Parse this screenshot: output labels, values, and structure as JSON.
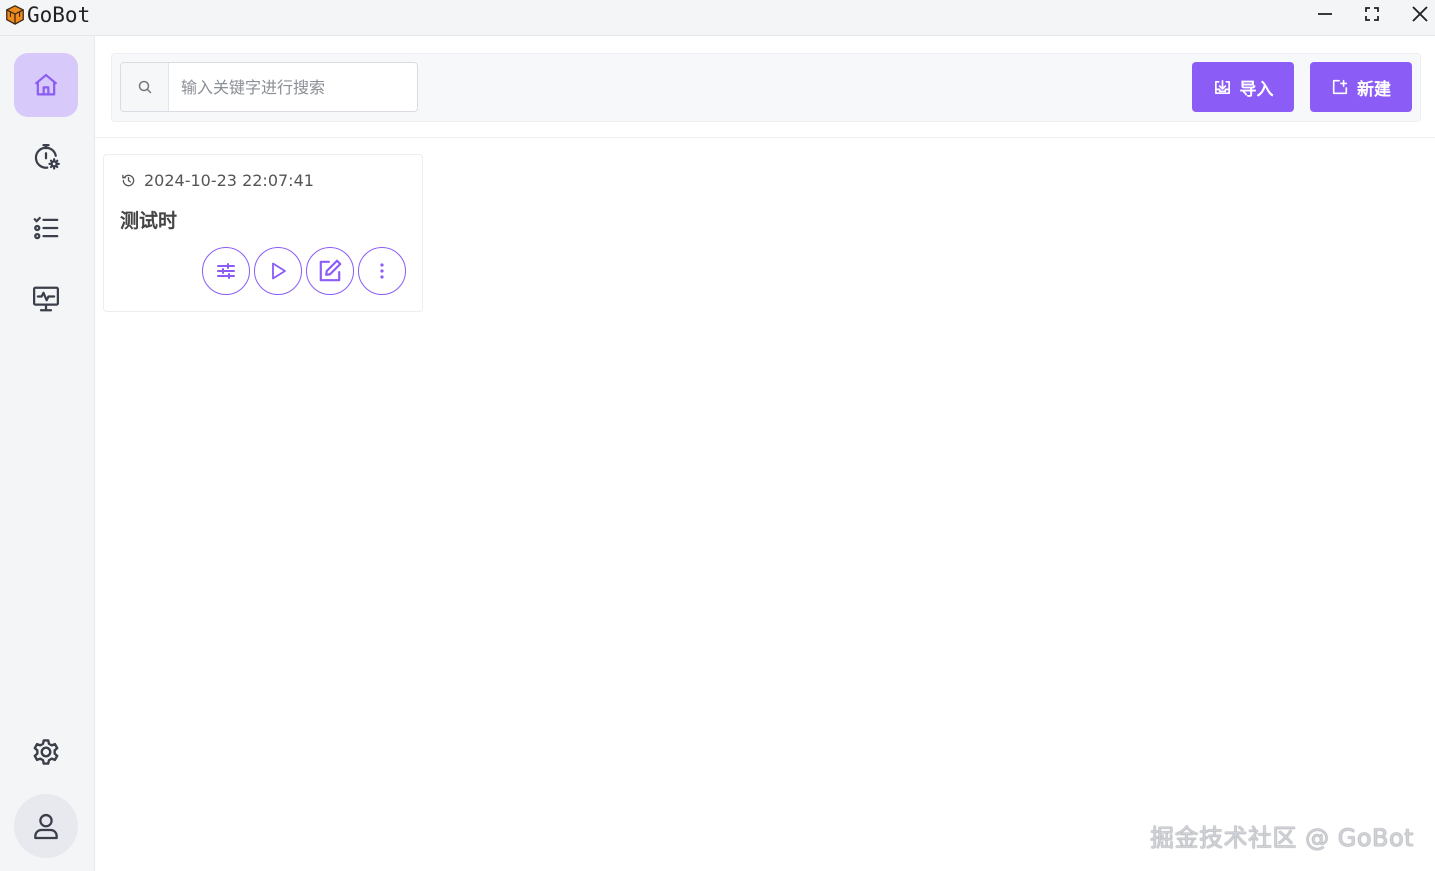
{
  "window": {
    "title": "GoBot",
    "controls": {
      "minimize": "minimize-icon",
      "maximize": "maximize-icon",
      "close": "close-icon"
    }
  },
  "sidebar": {
    "items": [
      {
        "id": "home",
        "icon": "home-icon",
        "active": true
      },
      {
        "id": "timer",
        "icon": "timer-settings-icon",
        "active": false
      },
      {
        "id": "list",
        "icon": "list-icon",
        "active": false
      },
      {
        "id": "monitor",
        "icon": "monitor-icon",
        "active": false
      }
    ],
    "bottom": [
      {
        "id": "settings",
        "icon": "gear-icon"
      },
      {
        "id": "user",
        "icon": "user-icon"
      }
    ]
  },
  "toolbar": {
    "search_placeholder": "输入关键字进行搜索",
    "search_value": "",
    "import_label": "导入",
    "new_label": "新建"
  },
  "cards": [
    {
      "timestamp": "2024-10-23 22:07:41",
      "title": "测试时",
      "actions": [
        "sliders-icon",
        "play-icon",
        "edit-icon",
        "more-vertical-icon"
      ]
    }
  ],
  "watermark": "掘金技术社区 @ GoBot",
  "colors": {
    "accent": "#8b5cf6",
    "active_bg": "#d8c9fb",
    "sidebar_bg": "#f4f5f7"
  }
}
